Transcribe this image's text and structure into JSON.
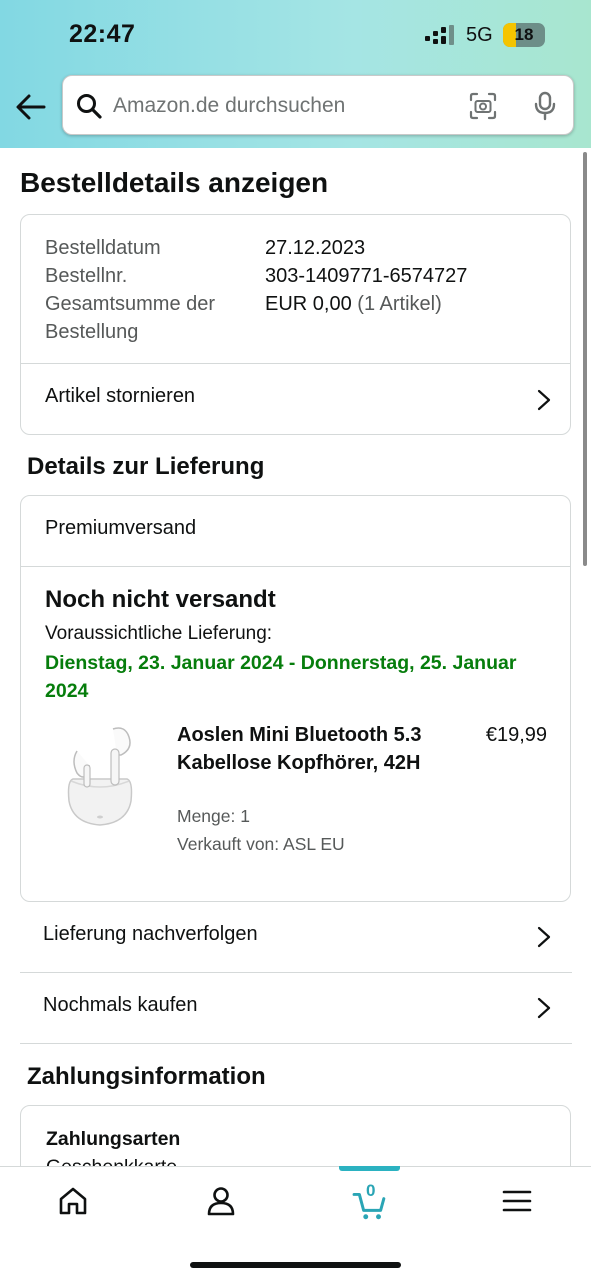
{
  "status_bar": {
    "time": "22:47",
    "network": "5G",
    "battery": "18"
  },
  "search": {
    "placeholder": "Amazon.de durchsuchen"
  },
  "page": {
    "title": "Bestelldetails anzeigen"
  },
  "order_summary": {
    "date_label": "Bestelldatum",
    "date_value": "27.12.2023",
    "number_label": "Bestellnr.",
    "number_value": "303-1409771-6574727",
    "total_label_line1": "Gesamtsumme der",
    "total_label_line2": "Bestellung",
    "total_value": "EUR 0,00",
    "total_items": "(1 Artikel)",
    "cancel_label": "Artikel stornieren"
  },
  "delivery": {
    "section_title": "Details zur Lieferung",
    "shipping_type": "Premiumversand",
    "status": "Noch nicht versandt",
    "eta_label": "Voraussichtliche Lieferung:",
    "eta_value": "Dienstag, 23. Januar 2024 - Donnerstag, 25. Januar 2024",
    "product": {
      "name": "Aoslen Mini Bluetooth 5.3 Kabellose Kopfhörer, 42H",
      "price": "€19,99",
      "quantity": "Menge: 1",
      "seller": "Verkauft von: ASL EU"
    },
    "track_label": "Lieferung nachverfolgen",
    "buy_again_label": "Nochmals kaufen"
  },
  "payment": {
    "section_title": "Zahlungsinformation",
    "methods_title": "Zahlungsarten",
    "method_value": "Geschenkkarte"
  },
  "tabbar": {
    "items": [
      {
        "icon": "home-icon"
      },
      {
        "icon": "account-icon"
      },
      {
        "icon": "cart-icon",
        "count": "0",
        "active": true
      },
      {
        "icon": "menu-icon"
      }
    ],
    "active_color": "#2bb2c1"
  },
  "colors": {
    "delivery_green": "#067d0c",
    "text": "#0f1111",
    "muted": "#565959",
    "border": "#d5d9d9"
  }
}
